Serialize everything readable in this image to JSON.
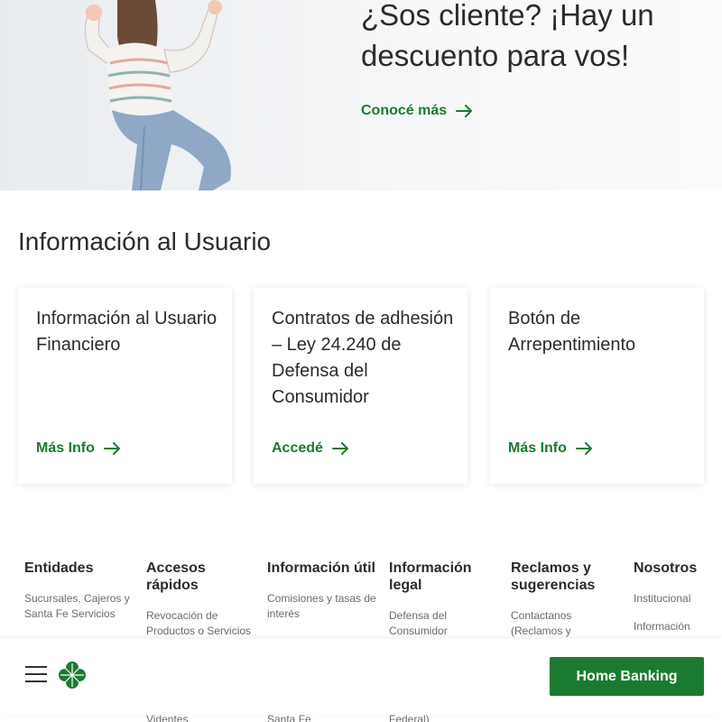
{
  "hero": {
    "title": "¿Sos cliente? ¡Hay un descuento para vos!",
    "link_label": "Conocé más"
  },
  "info_section": {
    "title": "Información al Usuario",
    "cards": [
      {
        "title": "Información al Usuario Financiero",
        "link": "Más Info"
      },
      {
        "title": "Contratos de adhesión – Ley 24.240 de Defensa del Consumidor",
        "link": "Accedé"
      },
      {
        "title": "Botón de Arrepentimiento",
        "link": "Más Info"
      }
    ]
  },
  "footer": {
    "columns": [
      {
        "heading": "Entidades",
        "links": [
          "Sucursales, Cajeros y Santa Fe Servicios"
        ]
      },
      {
        "heading": "Accesos rápidos",
        "links": [
          "Revocación de Productos o Servicios"
        ]
      },
      {
        "heading": "Información útil",
        "links": [
          "Comisiones y tasas de interés"
        ]
      },
      {
        "heading": "Información legal",
        "links": [
          "Defensa del Consumidor"
        ]
      },
      {
        "heading": "Reclamos y sugerencias",
        "links": [
          "Contactanos (Reclamos y"
        ]
      },
      {
        "heading": "Nosotros",
        "links": [
          "Institucional",
          "Información"
        ]
      }
    ],
    "partial_below": [
      "Videntes",
      "Santa Fe",
      "Federal)"
    ]
  },
  "bottom_bar": {
    "home_banking_label": "Home Banking"
  },
  "colors": {
    "brand_green": "#1b7a32"
  },
  "icons": [
    "arrow-right-icon",
    "hamburger-menu-icon",
    "clover-logo-icon"
  ]
}
